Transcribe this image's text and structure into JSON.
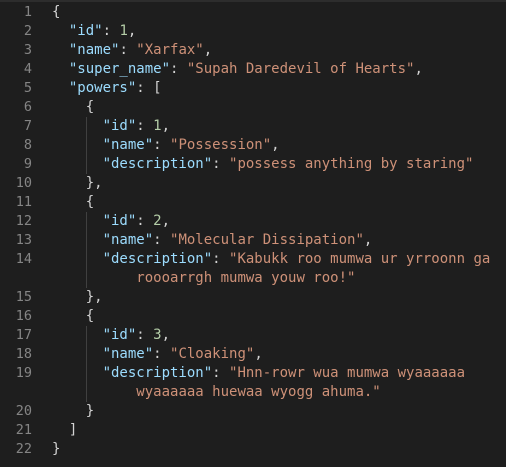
{
  "editor": {
    "line_numbers": [
      "1",
      "2",
      "3",
      "4",
      "5",
      "6",
      "7",
      "8",
      "9",
      "10",
      "11",
      "12",
      "13",
      "14",
      "",
      "15",
      "16",
      "17",
      "18",
      "19",
      "",
      "20",
      "21",
      "22"
    ],
    "rows": [
      {
        "indent": "",
        "tokens": [
          [
            "p",
            "{"
          ]
        ]
      },
      {
        "indent": "  ",
        "tokens": [
          [
            "k",
            "\"id\""
          ],
          [
            "p",
            ": "
          ],
          [
            "n",
            "1"
          ],
          [
            "p",
            ","
          ]
        ]
      },
      {
        "indent": "  ",
        "tokens": [
          [
            "k",
            "\"name\""
          ],
          [
            "p",
            ": "
          ],
          [
            "s",
            "\"Xarfax\""
          ],
          [
            "p",
            ","
          ]
        ]
      },
      {
        "indent": "  ",
        "tokens": [
          [
            "k",
            "\"super_name\""
          ],
          [
            "p",
            ": "
          ],
          [
            "s",
            "\"Supah Daredevil of Hearts\""
          ],
          [
            "p",
            ","
          ]
        ]
      },
      {
        "indent": "  ",
        "tokens": [
          [
            "k",
            "\"powers\""
          ],
          [
            "p",
            ": ["
          ]
        ]
      },
      {
        "indent": "    ",
        "tokens": [
          [
            "p",
            "{"
          ]
        ]
      },
      {
        "indent": "      ",
        "tokens": [
          [
            "k",
            "\"id\""
          ],
          [
            "p",
            ": "
          ],
          [
            "n",
            "1"
          ],
          [
            "p",
            ","
          ]
        ]
      },
      {
        "indent": "      ",
        "tokens": [
          [
            "k",
            "\"name\""
          ],
          [
            "p",
            ": "
          ],
          [
            "s",
            "\"Possession\""
          ],
          [
            "p",
            ","
          ]
        ]
      },
      {
        "indent": "      ",
        "tokens": [
          [
            "k",
            "\"description\""
          ],
          [
            "p",
            ": "
          ],
          [
            "s",
            "\"possess anything by staring\""
          ]
        ]
      },
      {
        "indent": "    ",
        "tokens": [
          [
            "p",
            "},"
          ]
        ]
      },
      {
        "indent": "    ",
        "tokens": [
          [
            "p",
            "{"
          ]
        ]
      },
      {
        "indent": "      ",
        "tokens": [
          [
            "k",
            "\"id\""
          ],
          [
            "p",
            ": "
          ],
          [
            "n",
            "2"
          ],
          [
            "p",
            ","
          ]
        ]
      },
      {
        "indent": "      ",
        "tokens": [
          [
            "k",
            "\"name\""
          ],
          [
            "p",
            ": "
          ],
          [
            "s",
            "\"Molecular Dissipation\""
          ],
          [
            "p",
            ","
          ]
        ]
      },
      {
        "indent": "      ",
        "tokens": [
          [
            "k",
            "\"description\""
          ],
          [
            "p",
            ": "
          ],
          [
            "s",
            "\"Kabukk roo mumwa ur yrroonn ga"
          ]
        ]
      },
      {
        "indent": "          ",
        "tokens": [
          [
            "s",
            "roooarrgh mumwa youw roo!\""
          ]
        ]
      },
      {
        "indent": "    ",
        "tokens": [
          [
            "p",
            "},"
          ]
        ]
      },
      {
        "indent": "    ",
        "tokens": [
          [
            "p",
            "{"
          ]
        ]
      },
      {
        "indent": "      ",
        "tokens": [
          [
            "k",
            "\"id\""
          ],
          [
            "p",
            ": "
          ],
          [
            "n",
            "3"
          ],
          [
            "p",
            ","
          ]
        ]
      },
      {
        "indent": "      ",
        "tokens": [
          [
            "k",
            "\"name\""
          ],
          [
            "p",
            ": "
          ],
          [
            "s",
            "\"Cloaking\""
          ],
          [
            "p",
            ","
          ]
        ]
      },
      {
        "indent": "      ",
        "tokens": [
          [
            "k",
            "\"description\""
          ],
          [
            "p",
            ": "
          ],
          [
            "s",
            "\"Hnn-rowr wua mumwa wyaaaaaa"
          ]
        ]
      },
      {
        "indent": "          ",
        "tokens": [
          [
            "s",
            "wyaaaaaa huewaa wyogg ahuma.\""
          ]
        ]
      },
      {
        "indent": "    ",
        "tokens": [
          [
            "p",
            "}"
          ]
        ]
      },
      {
        "indent": "  ",
        "tokens": [
          [
            "p",
            "]"
          ]
        ]
      },
      {
        "indent": "",
        "tokens": [
          [
            "p",
            "}"
          ]
        ]
      }
    ],
    "colors": {
      "background": "#1e1e1e",
      "line_number": "#858585",
      "key": "#9cdcfe",
      "string": "#ce9178",
      "number": "#b5cea8",
      "punctuation": "#d4d4d4"
    }
  }
}
